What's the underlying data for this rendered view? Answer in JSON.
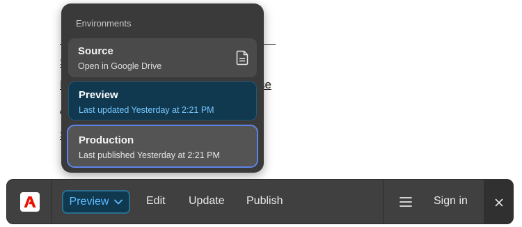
{
  "background": {
    "fragment_right": "se"
  },
  "environments": {
    "heading": "Environments",
    "items": [
      {
        "name": "Source",
        "subtitle": "Open in Google Drive",
        "icon": "file-icon"
      },
      {
        "name": "Preview",
        "subtitle": "Last updated Yesterday at 2:21 PM"
      },
      {
        "name": "Production",
        "subtitle": "Last published Yesterday at 2:21 PM"
      }
    ]
  },
  "toolbar": {
    "logo_icon": "adobe-logo-icon",
    "environment_label": "Preview",
    "edit_label": "Edit",
    "update_label": "Update",
    "publish_label": "Publish",
    "menu_icon": "hamburger-icon",
    "sign_in_label": "Sign in",
    "close_icon": "close-icon"
  },
  "colors": {
    "popover_bg": "#3a3a3a",
    "preview_bg": "#10384f",
    "preview_accent": "#5cbcff",
    "production_border": "#5d83e8",
    "toolbar_bg": "#404040",
    "adobe_red": "#eb1000"
  }
}
